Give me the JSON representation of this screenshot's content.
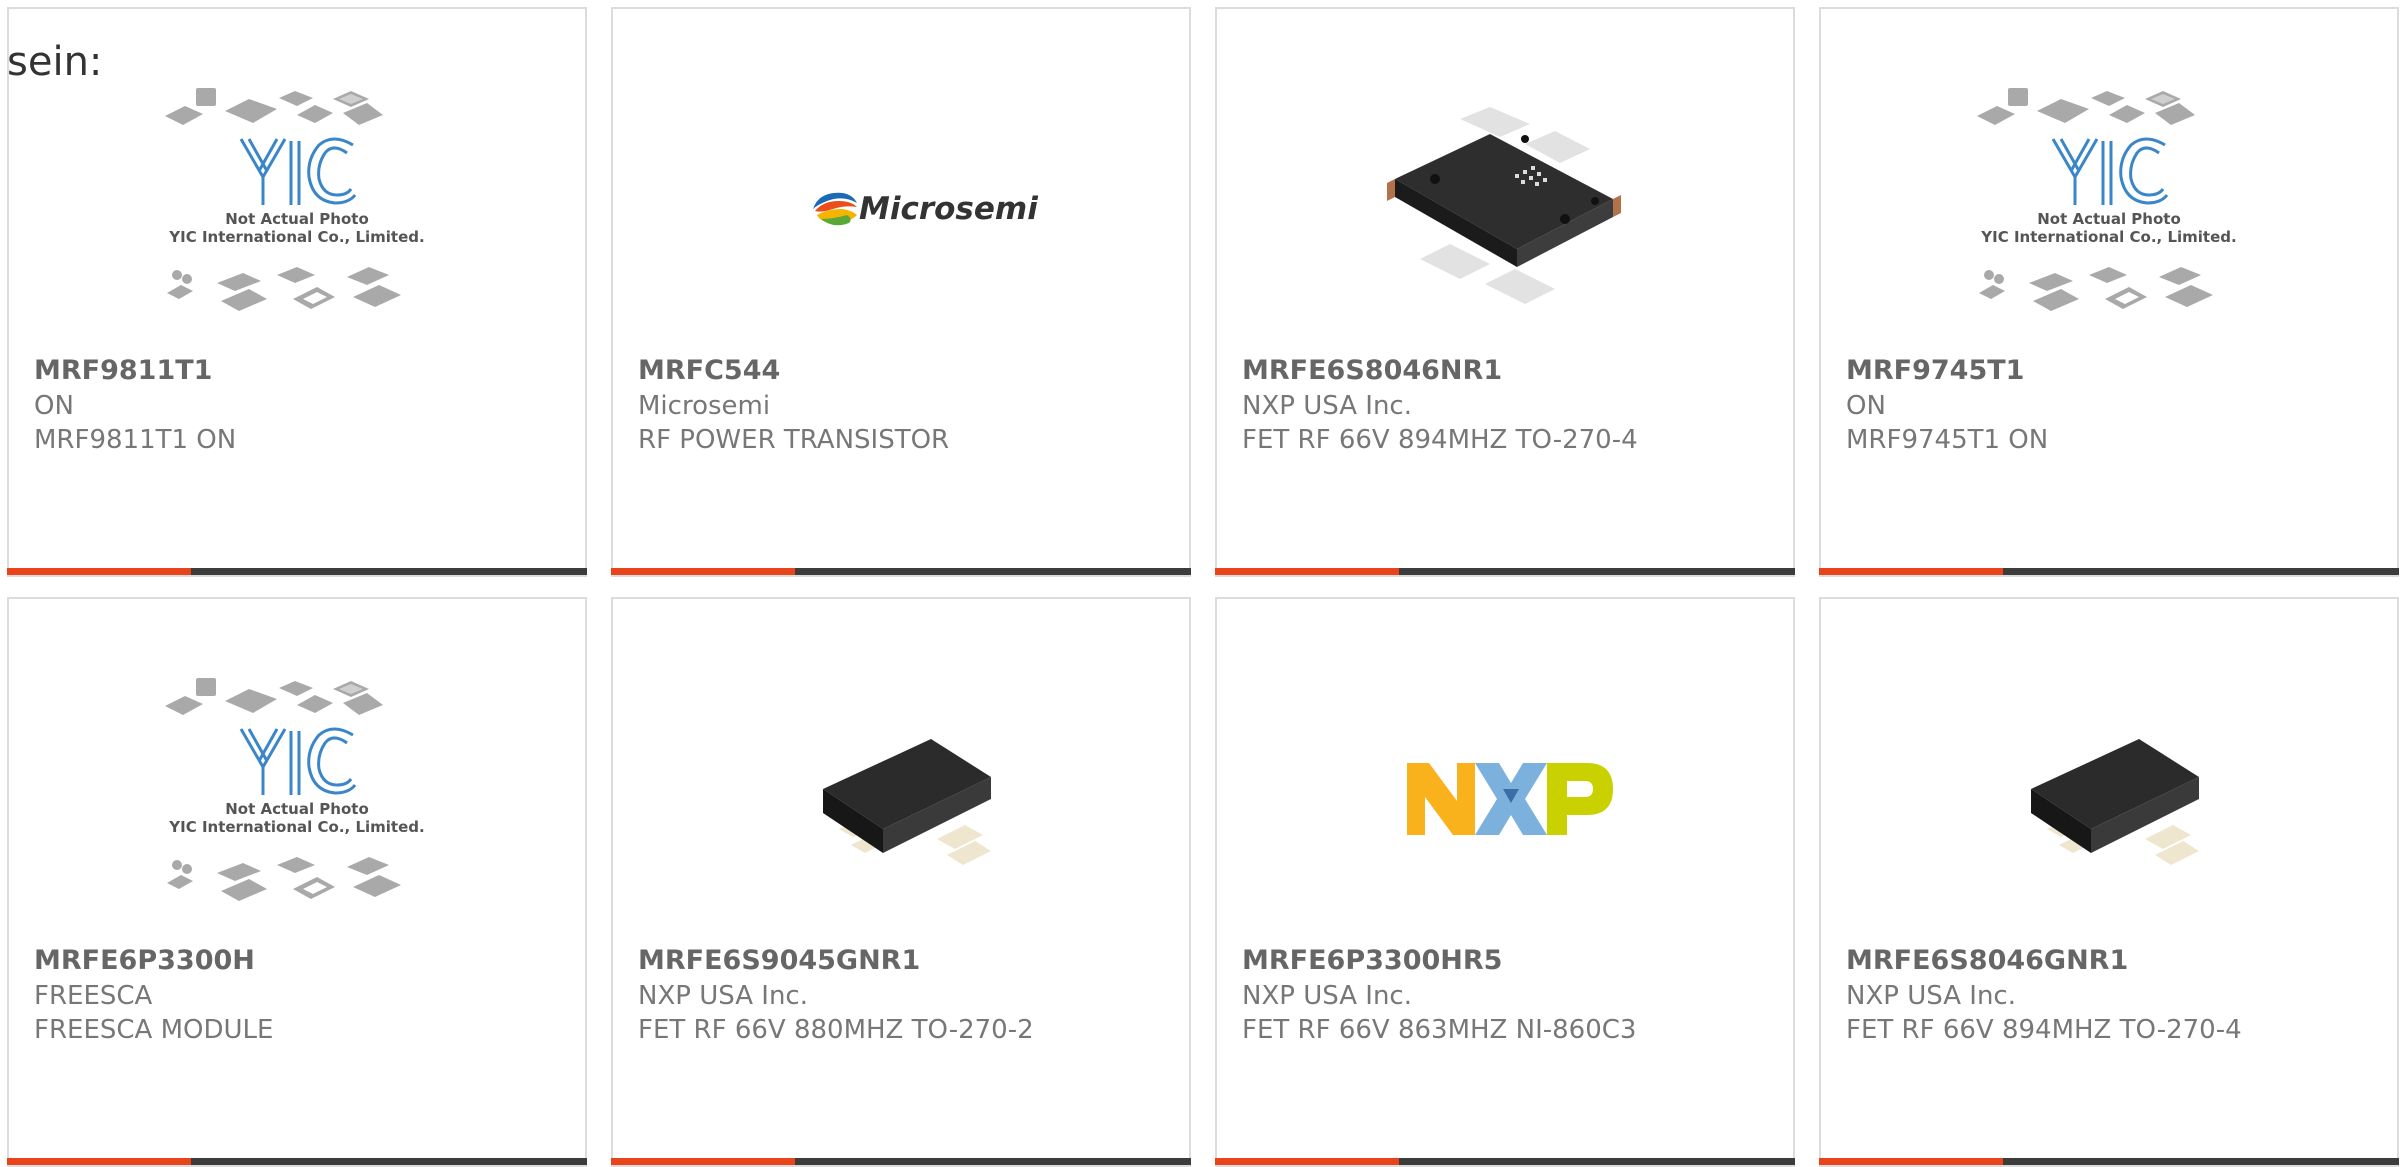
{
  "heading": "sein:",
  "accent_color": "#e8441c",
  "placeholder_image": {
    "line1": "Not Actual Photo",
    "line2": "YIC International Co., Limited.",
    "logo": "YIC"
  },
  "brand_logos": {
    "microsemi": "Microsemi"
  },
  "products": [
    {
      "mpn": "MRF9811T1",
      "manufacturer": "ON",
      "description": "MRF9811T1 ON",
      "image": "yic-placeholder"
    },
    {
      "mpn": "MRFC544",
      "manufacturer": "Microsemi",
      "description": "RF POWER TRANSISTOR",
      "image": "microsemi-logo"
    },
    {
      "mpn": "MRFE6S8046NR1",
      "manufacturer": "NXP USA Inc.",
      "description": "FET RF 66V 894MHZ TO-270-4",
      "image": "to270-4-package"
    },
    {
      "mpn": "MRF9745T1",
      "manufacturer": "ON",
      "description": "MRF9745T1 ON",
      "image": "yic-placeholder"
    },
    {
      "mpn": "MRFE6P3300H",
      "manufacturer": "FREESCA",
      "description": "FREESCA MODULE",
      "image": "yic-placeholder"
    },
    {
      "mpn": "MRFE6S9045GNR1",
      "manufacturer": "NXP USA Inc.",
      "description": "FET RF 66V 880MHZ TO-270-2",
      "image": "to270-2-package"
    },
    {
      "mpn": "MRFE6P3300HR5",
      "manufacturer": "NXP USA Inc.",
      "description": "FET RF 66V 863MHZ NI-860C3",
      "image": "nxp-logo"
    },
    {
      "mpn": "MRFE6S8046GNR1",
      "manufacturer": "NXP USA Inc.",
      "description": "FET RF 66V 894MHZ TO-270-4",
      "image": "to270-2-package"
    }
  ]
}
